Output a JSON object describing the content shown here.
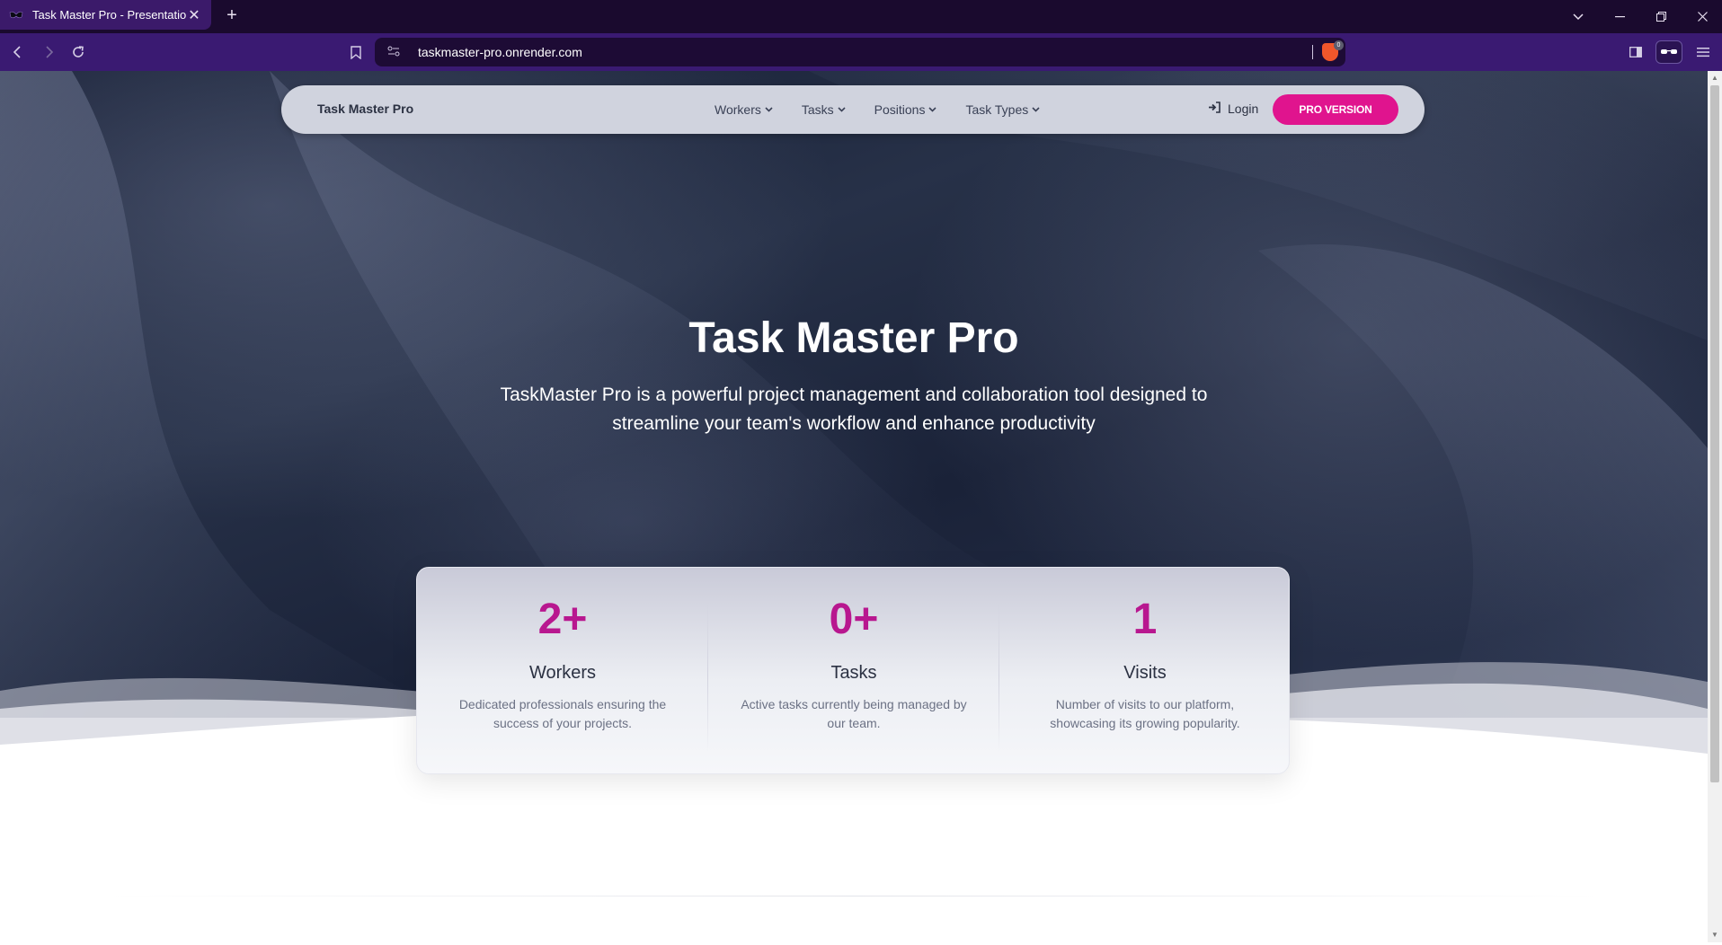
{
  "browser": {
    "tab_title": "Task Master Pro - Presentation",
    "tab_close": "✕",
    "new_tab": "+",
    "url": "taskmaster-pro.onrender.com",
    "shield_count": "0"
  },
  "nav": {
    "brand": "Task Master Pro",
    "menu": [
      {
        "label": "Workers"
      },
      {
        "label": "Tasks"
      },
      {
        "label": "Positions"
      },
      {
        "label": "Task Types"
      }
    ],
    "login": "Login",
    "pro_button": "PRO VERSION"
  },
  "hero": {
    "title": "Task Master Pro",
    "subtitle": "TaskMaster Pro is a powerful project management and collaboration tool designed to streamline your team's workflow and enhance productivity"
  },
  "stats": [
    {
      "value": "2+",
      "label": "Workers",
      "desc": "Dedicated professionals ensuring the success of your projects."
    },
    {
      "value": "0+",
      "label": "Tasks",
      "desc": "Active tasks currently being managed by our team."
    },
    {
      "value": "1",
      "label": "Visits",
      "desc": "Number of visits to our platform, showcasing its growing popularity."
    }
  ],
  "colors": {
    "accent": "#e0148e",
    "stat_value": "#b8178f",
    "browser_tabbar": "#1a0a2e",
    "browser_toolbar": "#3a1a72"
  }
}
